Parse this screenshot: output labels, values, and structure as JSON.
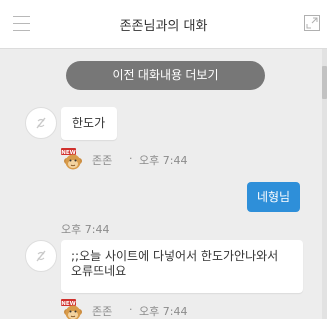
{
  "header": {
    "title": "존존님과의 대화"
  },
  "chat": {
    "load_more_label": "이전 대화내용 더보기",
    "messages": [
      {
        "direction": "in",
        "text": "한도가",
        "sender": "존존",
        "time": "오후 7:44"
      },
      {
        "direction": "out",
        "text": "네형님",
        "time": "오후 7:44"
      },
      {
        "direction": "in",
        "text_lines": [
          ";;오늘 사이트에 다넣어서 한도가안나와서",
          "오류뜨네요"
        ],
        "sender": "존존",
        "time": "오후 7:44"
      }
    ],
    "sticker_badge": "NEW"
  },
  "colors": {
    "outgoing_bubble": "#2e8fd9",
    "chat_background": "#ededed",
    "load_more_button": "#777777"
  },
  "icons": {
    "menu": "hamburger-menu-icon",
    "expand": "expand-window-icon",
    "avatar": "default-avatar-icon",
    "sticker": "monkey-sticker-icon"
  }
}
